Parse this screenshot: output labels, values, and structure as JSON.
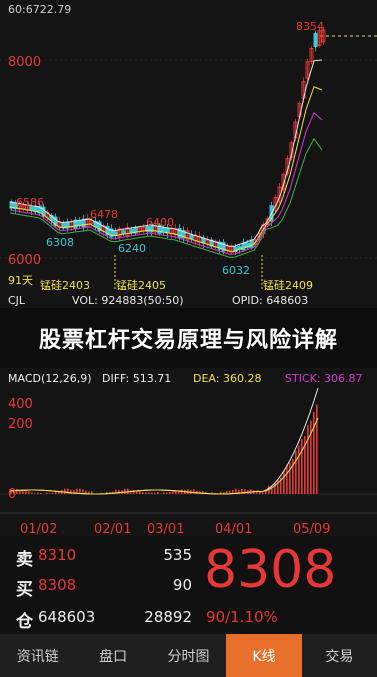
{
  "header": {
    "hover_value": "60:6722.79"
  },
  "kline": {
    "y_axis_labels": {
      "top": "8000",
      "bottom": "6000"
    },
    "price_labels": {
      "high_left": "6586",
      "mid_high": "6478",
      "second_high": "6400",
      "low_left": "6308",
      "low_mid": "6240",
      "low_right": "6032",
      "peak": "8354"
    },
    "contract_labels": [
      "锰硅2403",
      "锰硅2405",
      "锰硅2409"
    ],
    "period_label": "91天",
    "colors": {
      "up": "#e53935",
      "down": "#39c6d6",
      "ma_white": "#e8e8e8",
      "ma_yellow": "#f2e14b",
      "ma_magenta": "#d43ad0",
      "ma_green": "#3ab54a"
    }
  },
  "volume_row": {
    "symbol": "CJL",
    "vol": "VOL: 924883(50:50)",
    "opid": "OPID: 648603"
  },
  "banner": {
    "title": "股票杠杆交易原理与风险详解"
  },
  "macd_row": {
    "name": "MACD(12,26,9)",
    "diff": "DIFF: 513.71",
    "dea": "DEA: 360.28",
    "stick": "STICK: 306.87"
  },
  "macd": {
    "y_labels": [
      "400",
      "200",
      "0"
    ],
    "x_labels": [
      "01/02",
      "02/01",
      "03/01",
      "04/01",
      "05/09"
    ]
  },
  "quote": {
    "sell": {
      "label": "卖",
      "price": "8310",
      "qty": "535"
    },
    "buy": {
      "label": "买",
      "price": "8308",
      "qty": "90"
    },
    "position": {
      "label": "仓",
      "value": "648603",
      "qty": "28892"
    },
    "last_price": "8308",
    "change": "90/1.10%"
  },
  "tabs": [
    {
      "label": "资讯链",
      "active": false
    },
    {
      "label": "盘口",
      "active": false
    },
    {
      "label": "分时图",
      "active": false
    },
    {
      "label": "K线",
      "active": true
    },
    {
      "label": "交易",
      "active": false
    }
  ]
}
